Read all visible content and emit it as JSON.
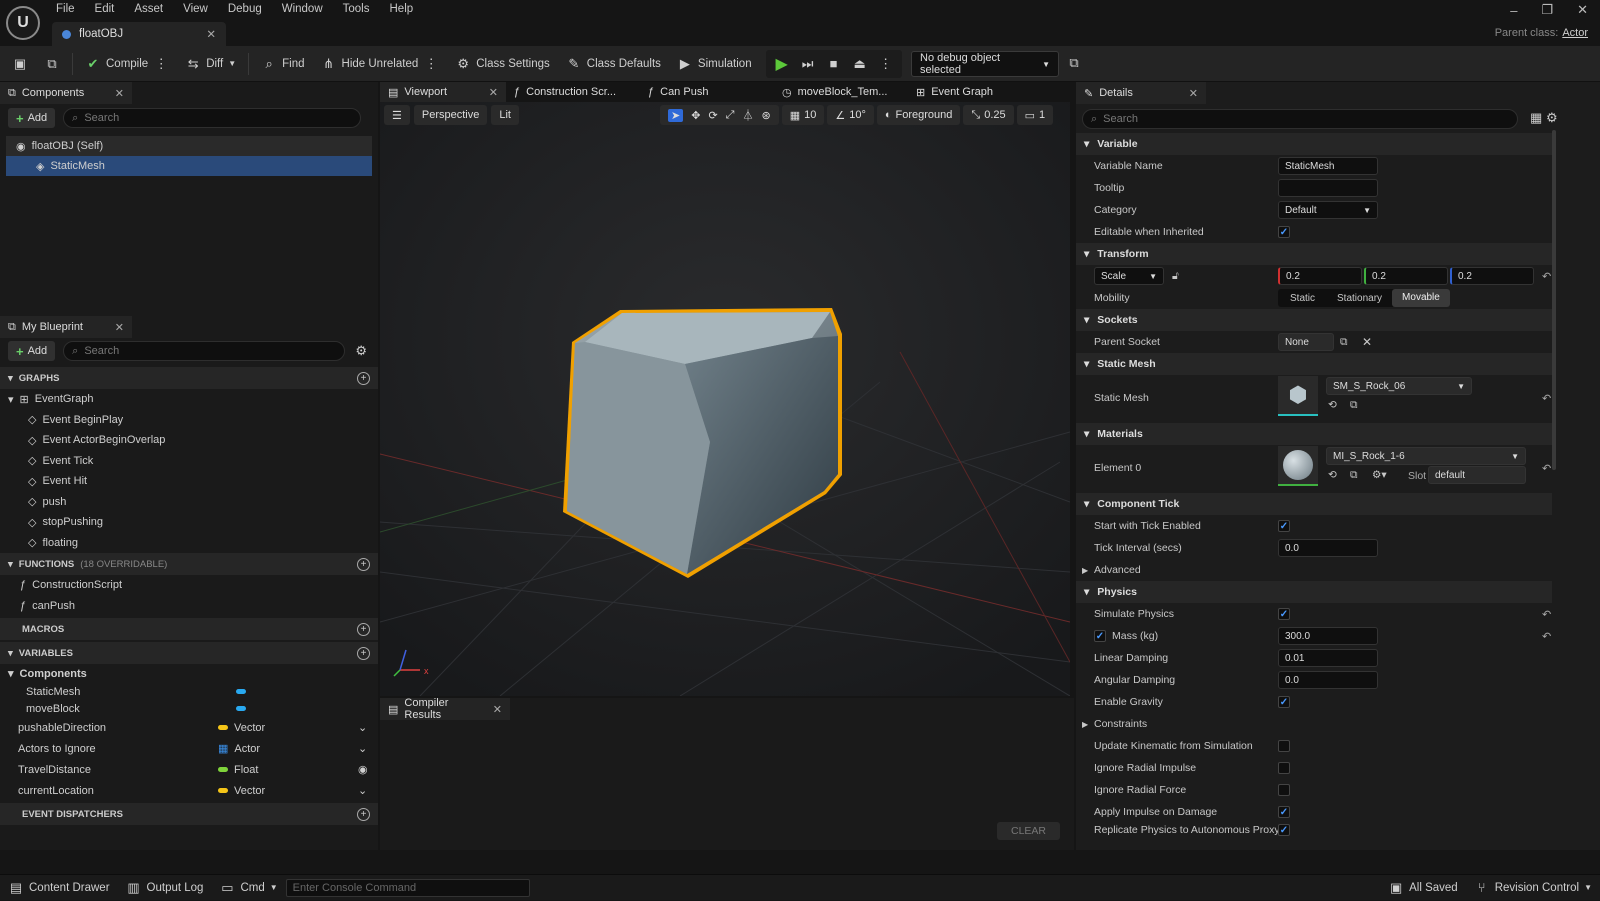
{
  "menu": [
    "File",
    "Edit",
    "Asset",
    "View",
    "Debug",
    "Window",
    "Tools",
    "Help"
  ],
  "doc_tab": "floatOBJ",
  "parent_class": {
    "label": "Parent class:",
    "value": "Actor"
  },
  "toolbar": {
    "compile": "Compile",
    "diff": "Diff",
    "find": "Find",
    "hide_unrelated": "Hide Unrelated",
    "class_settings": "Class Settings",
    "class_defaults": "Class Defaults",
    "simulation": "Simulation",
    "debug_object": "No debug object selected"
  },
  "components": {
    "title": "Components",
    "add": "Add",
    "search": "Search",
    "self": "floatOBJ (Self)",
    "items": [
      "StaticMesh"
    ]
  },
  "my_blueprint": {
    "title": "My Blueprint",
    "add": "Add",
    "search": "Search",
    "graphs_label": "GRAPHS",
    "event_graph": "EventGraph",
    "events": [
      "Event BeginPlay",
      "Event ActorBeginOverlap",
      "Event Tick",
      "Event Hit",
      "push",
      "stopPushing",
      "floating"
    ],
    "functions_label": "FUNCTIONS",
    "functions_note": "(18 OVERRIDABLE)",
    "functions": [
      "ConstructionScript",
      "canPush"
    ],
    "macros_label": "MACROS",
    "variables_label": "VARIABLES",
    "components_group": "Components",
    "component_vars": [
      "StaticMesh",
      "moveBlock"
    ],
    "variables": [
      {
        "name": "pushableDirection",
        "type": "Vector",
        "color": "#f5c518"
      },
      {
        "name": "Actors to Ignore",
        "type": "Actor",
        "color": "#3a8fe8"
      },
      {
        "name": "TravelDistance",
        "type": "Float",
        "color": "#7fd43b"
      },
      {
        "name": "currentLocation",
        "type": "Vector",
        "color": "#f5c518"
      }
    ],
    "dispatchers_label": "EVENT DISPATCHERS"
  },
  "center_tabs": [
    "Viewport",
    "Construction Scr...",
    "Can Push",
    "moveBlock_Tem...",
    "Event Graph"
  ],
  "viewport": {
    "perspective": "Perspective",
    "lit": "Lit",
    "grid": "10",
    "angle": "10°",
    "foreground": "Foreground",
    "scale": "0.25",
    "camera": "1"
  },
  "compiler": {
    "title": "Compiler Results",
    "clear": "CLEAR"
  },
  "details": {
    "title": "Details",
    "search": "Search",
    "variable": {
      "label": "Variable",
      "name_label": "Variable Name",
      "name": "StaticMesh",
      "tooltip_label": "Tooltip",
      "category_label": "Category",
      "category": "Default",
      "editable_label": "Editable when Inherited"
    },
    "transform": {
      "label": "Transform",
      "scale_label": "Scale",
      "x": "0.2",
      "y": "0.2",
      "z": "0.2",
      "mobility_label": "Mobility",
      "mobility_options": [
        "Static",
        "Stationary",
        "Movable"
      ],
      "mobility_selected": "Movable"
    },
    "sockets": {
      "label": "Sockets",
      "parent_label": "Parent Socket",
      "parent": "None"
    },
    "static_mesh": {
      "label": "Static Mesh",
      "field_label": "Static Mesh",
      "value": "SM_S_Rock_06"
    },
    "materials": {
      "label": "Materials",
      "element_label": "Element 0",
      "value": "MI_S_Rock_1-6",
      "slot_label": "Slot",
      "slot": "default"
    },
    "component_tick": {
      "label": "Component Tick",
      "start_label": "Start with Tick Enabled",
      "interval_label": "Tick Interval (secs)",
      "interval": "0.0",
      "advanced": "Advanced"
    },
    "physics": {
      "label": "Physics",
      "simulate_label": "Simulate Physics",
      "mass_label": "Mass (kg)",
      "mass": "300.0",
      "linear_label": "Linear Damping",
      "linear": "0.01",
      "angular_label": "Angular Damping",
      "angular": "0.0",
      "gravity_label": "Enable Gravity",
      "constraints": "Constraints",
      "kinematic_label": "Update Kinematic from Simulation",
      "radial_impulse_label": "Ignore Radial Impulse",
      "radial_force_label": "Ignore Radial Force",
      "impulse_damage_label": "Apply Impulse on Damage",
      "replicate_label": "Replicate Physics to Autonomous Proxy"
    }
  },
  "status": {
    "content_drawer": "Content Drawer",
    "output_log": "Output Log",
    "cmd": "Cmd",
    "console_placeholder": "Enter Console Command",
    "saved": "All Saved",
    "revision": "Revision Control"
  },
  "colors": {
    "accent": "#4a86d8",
    "selection": "#2a4a7a",
    "outline": "#f0a000",
    "play": "#5cc83a"
  }
}
